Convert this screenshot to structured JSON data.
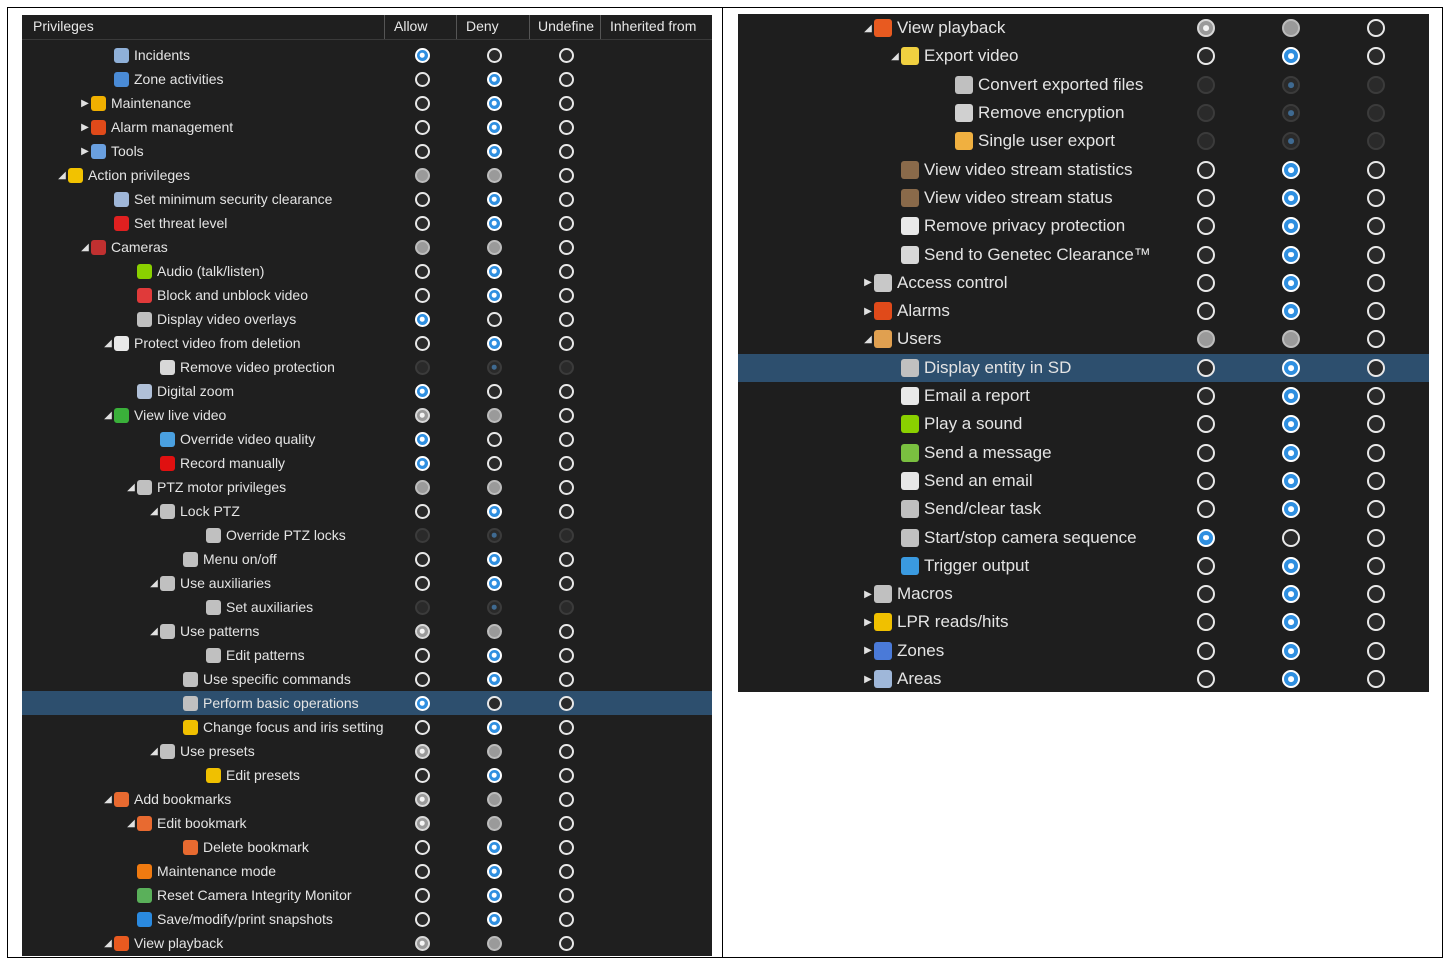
{
  "left": {
    "columns": {
      "privileges": "Privileges",
      "allow": "Allow",
      "deny": "Deny",
      "undefine": "Undefine",
      "inherited": "Inherited from"
    },
    "rows": [
      {
        "label": "Incidents",
        "depth": 4,
        "arrow": "",
        "icon": "incident-icon",
        "color": "#8fb0d8",
        "state": [
          "on",
          "off",
          "off"
        ]
      },
      {
        "label": "Zone activities",
        "depth": 4,
        "arrow": "",
        "icon": "zone-activities-icon",
        "color": "#4a8bd6",
        "state": [
          "off",
          "on",
          "off"
        ]
      },
      {
        "label": "Maintenance",
        "depth": 3,
        "arrow": "right",
        "icon": "maintenance-icon",
        "color": "#f0b000",
        "state": [
          "off",
          "on",
          "off"
        ]
      },
      {
        "label": "Alarm management",
        "depth": 3,
        "arrow": "right",
        "icon": "alarm-icon",
        "color": "#e04a1a",
        "state": [
          "off",
          "on",
          "off"
        ]
      },
      {
        "label": "Tools",
        "depth": 3,
        "arrow": "right",
        "icon": "tools-icon",
        "color": "#6aa0e0",
        "state": [
          "off",
          "on",
          "off"
        ]
      },
      {
        "label": "Action privileges",
        "depth": 2,
        "arrow": "down",
        "icon": "action-icon",
        "color": "#f2c200",
        "state": [
          "ind",
          "ind",
          "off"
        ]
      },
      {
        "label": "Set minimum security clearance",
        "depth": 4,
        "arrow": "",
        "icon": "clearance-icon",
        "color": "#9fb7d9",
        "state": [
          "off",
          "on",
          "off"
        ]
      },
      {
        "label": "Set threat level",
        "depth": 4,
        "arrow": "",
        "icon": "threat-icon",
        "color": "#e02020",
        "state": [
          "off",
          "on",
          "off"
        ]
      },
      {
        "label": "Cameras",
        "depth": 3,
        "arrow": "down",
        "icon": "camera-icon",
        "color": "#c03030",
        "state": [
          "ind",
          "ind",
          "off"
        ]
      },
      {
        "label": "Audio (talk/listen)",
        "depth": 5,
        "arrow": "",
        "icon": "audio-icon",
        "color": "#8ad000",
        "state": [
          "off",
          "on",
          "off"
        ]
      },
      {
        "label": "Block and unblock video",
        "depth": 5,
        "arrow": "",
        "icon": "block-icon",
        "color": "#e03a3a",
        "state": [
          "off",
          "on",
          "off"
        ]
      },
      {
        "label": "Display video overlays",
        "depth": 5,
        "arrow": "",
        "icon": "key-icon",
        "color": "#c0c0c0",
        "state": [
          "on",
          "off",
          "off"
        ]
      },
      {
        "label": "Protect video from deletion",
        "depth": 4,
        "arrow": "down",
        "icon": "protect-icon",
        "color": "#e8e8e8",
        "state": [
          "off",
          "on",
          "off"
        ]
      },
      {
        "label": "Remove video protection",
        "depth": 6,
        "arrow": "",
        "icon": "unprotect-icon",
        "color": "#d8d8d8",
        "state": [
          "dis",
          "dison",
          "dis"
        ]
      },
      {
        "label": "Digital zoom",
        "depth": 5,
        "arrow": "",
        "icon": "zoom-icon",
        "color": "#b0c0d8",
        "state": [
          "on",
          "off",
          "off"
        ]
      },
      {
        "label": "View live video",
        "depth": 4,
        "arrow": "down",
        "icon": "live-video-icon",
        "color": "#3ab03a",
        "state": [
          "indon",
          "ind",
          "off"
        ]
      },
      {
        "label": "Override video quality",
        "depth": 6,
        "arrow": "",
        "icon": "quality-icon",
        "color": "#4aa0e0",
        "state": [
          "on",
          "off",
          "off"
        ]
      },
      {
        "label": "Record manually",
        "depth": 6,
        "arrow": "",
        "icon": "record-icon",
        "color": "#e01010",
        "state": [
          "on",
          "off",
          "off"
        ]
      },
      {
        "label": "PTZ motor privileges",
        "depth": 5,
        "arrow": "down",
        "icon": "ptz-icon",
        "color": "#c0c0c0",
        "state": [
          "ind",
          "ind",
          "off"
        ]
      },
      {
        "label": "Lock PTZ",
        "depth": 6,
        "arrow": "down",
        "icon": "key-icon",
        "color": "#c0c0c0",
        "state": [
          "off",
          "on",
          "off"
        ]
      },
      {
        "label": "Override PTZ locks",
        "depth": 8,
        "arrow": "",
        "icon": "key-icon",
        "color": "#c0c0c0",
        "state": [
          "dis",
          "dison",
          "dis"
        ]
      },
      {
        "label": "Menu on/off",
        "depth": 7,
        "arrow": "",
        "icon": "menu-icon",
        "color": "#c0c0c0",
        "state": [
          "off",
          "on",
          "off"
        ]
      },
      {
        "label": "Use auxiliaries",
        "depth": 6,
        "arrow": "down",
        "icon": "key-icon",
        "color": "#c0c0c0",
        "state": [
          "off",
          "on",
          "off"
        ]
      },
      {
        "label": "Set auxiliaries",
        "depth": 8,
        "arrow": "",
        "icon": "key-icon",
        "color": "#c0c0c0",
        "state": [
          "dis",
          "dison",
          "dis"
        ]
      },
      {
        "label": "Use patterns",
        "depth": 6,
        "arrow": "down",
        "icon": "key-icon",
        "color": "#c0c0c0",
        "state": [
          "indon",
          "ind",
          "off"
        ]
      },
      {
        "label": "Edit patterns",
        "depth": 8,
        "arrow": "",
        "icon": "key-icon",
        "color": "#c0c0c0",
        "state": [
          "off",
          "on",
          "off"
        ]
      },
      {
        "label": "Use specific commands",
        "depth": 7,
        "arrow": "",
        "icon": "key-icon",
        "color": "#c0c0c0",
        "state": [
          "off",
          "on",
          "off"
        ]
      },
      {
        "label": "Perform basic operations",
        "depth": 7,
        "arrow": "",
        "icon": "key-icon",
        "color": "#c0c0c0",
        "state": [
          "on",
          "off",
          "off"
        ],
        "selected": true
      },
      {
        "label": "Change focus and iris setting",
        "depth": 7,
        "arrow": "",
        "icon": "focus-icon",
        "color": "#f0c000",
        "state": [
          "off",
          "on",
          "off"
        ]
      },
      {
        "label": "Use presets",
        "depth": 6,
        "arrow": "down",
        "icon": "key-icon",
        "color": "#c0c0c0",
        "state": [
          "indon",
          "ind",
          "off"
        ]
      },
      {
        "label": "Edit presets",
        "depth": 8,
        "arrow": "",
        "icon": "pencil-icon",
        "color": "#f0c000",
        "state": [
          "off",
          "on",
          "off"
        ]
      },
      {
        "label": "Add bookmarks",
        "depth": 4,
        "arrow": "down",
        "icon": "bookmark-icon",
        "color": "#e86a30",
        "state": [
          "indon",
          "ind",
          "off"
        ]
      },
      {
        "label": "Edit bookmark",
        "depth": 5,
        "arrow": "down",
        "icon": "bookmark-icon",
        "color": "#e86a30",
        "state": [
          "indon",
          "ind",
          "off"
        ]
      },
      {
        "label": "Delete bookmark",
        "depth": 7,
        "arrow": "",
        "icon": "bookmark-icon",
        "color": "#e86a30",
        "state": [
          "off",
          "on",
          "off"
        ]
      },
      {
        "label": "Maintenance mode",
        "depth": 5,
        "arrow": "",
        "icon": "cone-icon",
        "color": "#f07a10",
        "state": [
          "off",
          "on",
          "off"
        ]
      },
      {
        "label": "Reset Camera Integrity Monitor",
        "depth": 5,
        "arrow": "",
        "icon": "integrity-icon",
        "color": "#5ab05a",
        "state": [
          "off",
          "on",
          "off"
        ]
      },
      {
        "label": "Save/modify/print snapshots",
        "depth": 5,
        "arrow": "",
        "icon": "snapshot-icon",
        "color": "#2a8ae0",
        "state": [
          "off",
          "on",
          "off"
        ]
      },
      {
        "label": "View playback",
        "depth": 4,
        "arrow": "down",
        "icon": "playback-icon",
        "color": "#e85a20",
        "state": [
          "indon",
          "ind",
          "off"
        ]
      }
    ]
  },
  "right": {
    "rows": [
      {
        "label": "View playback",
        "depth": 4,
        "arrow": "down",
        "icon": "playback-icon",
        "color": "#e85a20",
        "state": [
          "indon",
          "ind",
          "off"
        ]
      },
      {
        "label": "Export video",
        "depth": 5,
        "arrow": "down",
        "icon": "export-icon",
        "color": "#f0d040",
        "state": [
          "off",
          "on",
          "off"
        ]
      },
      {
        "label": "Convert exported files",
        "depth": 7,
        "arrow": "",
        "icon": "key-icon",
        "color": "#c0c0c0",
        "state": [
          "dis",
          "dison",
          "dis"
        ]
      },
      {
        "label": "Remove encryption",
        "depth": 7,
        "arrow": "",
        "icon": "unlock-icon",
        "color": "#d0d0d0",
        "state": [
          "dis",
          "dison",
          "dis"
        ]
      },
      {
        "label": "Single user export",
        "depth": 7,
        "arrow": "",
        "icon": "user-key-icon",
        "color": "#f0b040",
        "state": [
          "dis",
          "dison",
          "dis"
        ]
      },
      {
        "label": "View video stream statistics",
        "depth": 5,
        "arrow": "",
        "icon": "stream-icon",
        "color": "#8a6a4a",
        "state": [
          "off",
          "on",
          "off"
        ]
      },
      {
        "label": "View video stream status",
        "depth": 5,
        "arrow": "",
        "icon": "stream-icon",
        "color": "#8a6a4a",
        "state": [
          "off",
          "on",
          "off"
        ]
      },
      {
        "label": "Remove privacy protection",
        "depth": 5,
        "arrow": "",
        "icon": "eye-icon",
        "color": "#e8e8e8",
        "state": [
          "off",
          "on",
          "off"
        ]
      },
      {
        "label": "Send to Genetec Clearance™",
        "depth": 5,
        "arrow": "",
        "icon": "send-icon",
        "color": "#d8d8d8",
        "state": [
          "off",
          "on",
          "off"
        ]
      },
      {
        "label": "Access control",
        "depth": 4,
        "arrow": "right",
        "icon": "access-icon",
        "color": "#c8c8c8",
        "state": [
          "off",
          "on",
          "off"
        ]
      },
      {
        "label": "Alarms",
        "depth": 4,
        "arrow": "right",
        "icon": "alarm-icon",
        "color": "#e04a1a",
        "state": [
          "off",
          "on",
          "off"
        ]
      },
      {
        "label": "Users",
        "depth": 4,
        "arrow": "down",
        "icon": "users-icon",
        "color": "#e0a050",
        "state": [
          "ind",
          "ind",
          "off"
        ]
      },
      {
        "label": "Display entity in SD",
        "depth": 5,
        "arrow": "",
        "icon": "key-icon",
        "color": "#c0c0c0",
        "state": [
          "off",
          "on",
          "off"
        ],
        "selected": true
      },
      {
        "label": "Email a report",
        "depth": 5,
        "arrow": "",
        "icon": "email-icon",
        "color": "#e8e8e8",
        "state": [
          "off",
          "on",
          "off"
        ]
      },
      {
        "label": "Play a sound",
        "depth": 5,
        "arrow": "",
        "icon": "sound-icon",
        "color": "#8ad000",
        "state": [
          "off",
          "on",
          "off"
        ]
      },
      {
        "label": "Send a message",
        "depth": 5,
        "arrow": "",
        "icon": "message-icon",
        "color": "#7ac040",
        "state": [
          "off",
          "on",
          "off"
        ]
      },
      {
        "label": "Send an email",
        "depth": 5,
        "arrow": "",
        "icon": "email-icon",
        "color": "#e8e8e8",
        "state": [
          "off",
          "on",
          "off"
        ]
      },
      {
        "label": "Send/clear task",
        "depth": 5,
        "arrow": "",
        "icon": "task-icon",
        "color": "#c0c0c0",
        "state": [
          "off",
          "on",
          "off"
        ]
      },
      {
        "label": "Start/stop camera sequence",
        "depth": 5,
        "arrow": "",
        "icon": "sequence-icon",
        "color": "#c0c0c0",
        "state": [
          "on",
          "off",
          "off"
        ]
      },
      {
        "label": "Trigger output",
        "depth": 5,
        "arrow": "",
        "icon": "trigger-icon",
        "color": "#3a9ae0",
        "state": [
          "off",
          "on",
          "off"
        ]
      },
      {
        "label": "Macros",
        "depth": 4,
        "arrow": "right",
        "icon": "macro-icon",
        "color": "#c0c0c0",
        "state": [
          "off",
          "on",
          "off"
        ]
      },
      {
        "label": "LPR reads/hits",
        "depth": 4,
        "arrow": "right",
        "icon": "lpr-icon",
        "color": "#f0c000",
        "state": [
          "off",
          "on",
          "off"
        ]
      },
      {
        "label": "Zones",
        "depth": 4,
        "arrow": "right",
        "icon": "zones-icon",
        "color": "#4a7ad8",
        "state": [
          "off",
          "on",
          "off"
        ]
      },
      {
        "label": "Areas",
        "depth": 4,
        "arrow": "right",
        "icon": "areas-icon",
        "color": "#9fb7d9",
        "state": [
          "off",
          "on",
          "off"
        ]
      }
    ]
  }
}
